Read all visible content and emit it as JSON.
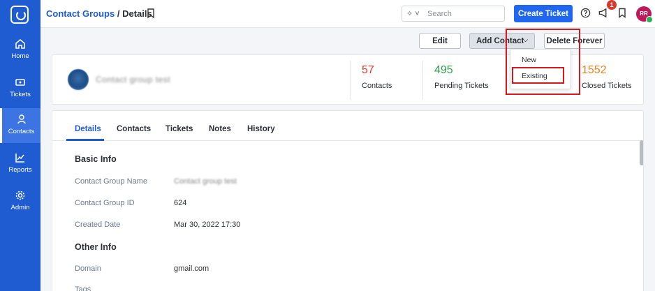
{
  "sidebar": {
    "items": [
      {
        "label": "Home",
        "icon": "home-icon"
      },
      {
        "label": "Tickets",
        "icon": "ticket-icon"
      },
      {
        "label": "Contacts",
        "icon": "user-icon"
      },
      {
        "label": "Reports",
        "icon": "chart-icon"
      },
      {
        "label": "Admin",
        "icon": "gear-icon"
      }
    ],
    "active": "Contacts"
  },
  "header": {
    "breadcrumb_link": "Contact Groups",
    "breadcrumb_sep": "/",
    "breadcrumb_current": "Details",
    "search_placeholder": "Search",
    "create_ticket": "Create Ticket",
    "notification_count": "1",
    "avatar_initials": "RR"
  },
  "actions": {
    "edit": "Edit",
    "add_contact": "Add Contact",
    "delete_forever": "Delete Forever",
    "dropdown": [
      "New",
      "Existing"
    ]
  },
  "summary": {
    "group_name": "Contact group test",
    "stats": [
      {
        "value": "57",
        "label": "Contacts",
        "color": "#e0392b"
      },
      {
        "value": "495",
        "label": "Pending Tickets",
        "color": "#2ba14a"
      },
      {
        "value": "1552",
        "label": "Closed Tickets",
        "color": "#f07f22"
      }
    ]
  },
  "tabs": [
    "Details",
    "Contacts",
    "Tickets",
    "Notes",
    "History"
  ],
  "basic_info": {
    "heading": "Basic Info",
    "fields": [
      {
        "label": "Contact Group Name",
        "value": "Contact group test"
      },
      {
        "label": "Contact Group ID",
        "value": "624"
      },
      {
        "label": "Created Date",
        "value": "Mar 30, 2022 17:30"
      }
    ]
  },
  "other_info": {
    "heading": "Other Info",
    "fields": [
      {
        "label": "Domain",
        "value": "gmail.com"
      },
      {
        "label": "Tags",
        "value": ""
      }
    ]
  },
  "colors": {
    "sidebar": "#1f5bd1",
    "primary": "#1f66f0",
    "highlight": "#d9181e"
  }
}
